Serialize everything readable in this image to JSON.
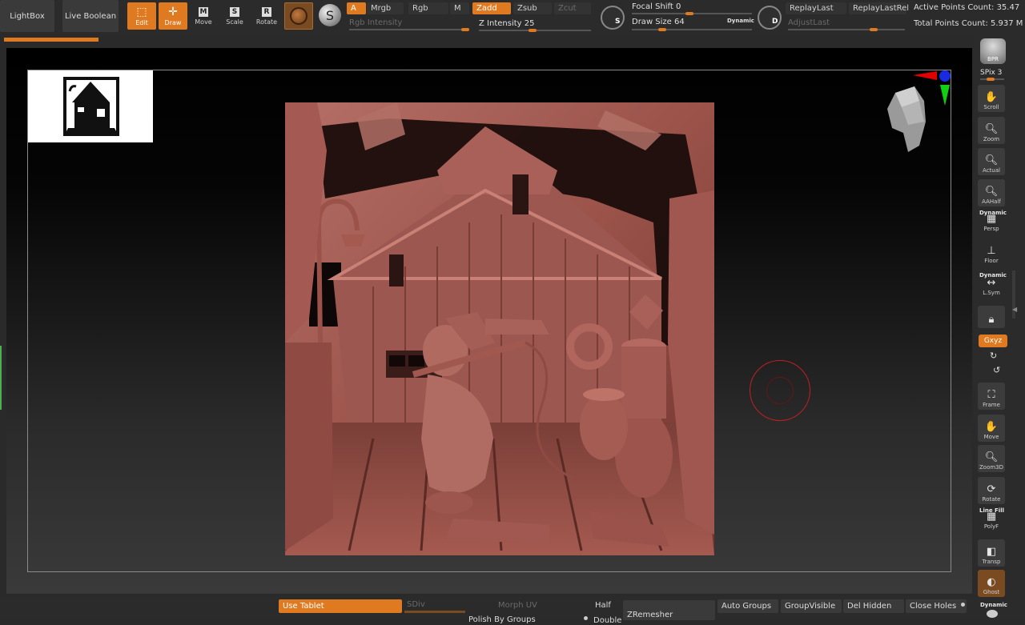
{
  "topbar": {
    "lightbox": "LightBox",
    "live_boolean": "Live Boolean",
    "tools": {
      "edit": "Edit",
      "draw": "Draw",
      "move": "Move",
      "scale": "Scale",
      "rotate": "Rotate"
    },
    "modes": {
      "a": "A",
      "mrgb": "Mrgb",
      "rgb": "Rgb",
      "m": "M",
      "zadd": "Zadd",
      "zsub": "Zsub",
      "zcut": "Zcut"
    },
    "rgb_intensity": "Rgb Intensity",
    "z_intensity": "Z Intensity 25",
    "focal_shift": "Focal Shift 0",
    "draw_size": "Draw Size 64",
    "dynamic": "Dynamic",
    "replay_last": "ReplayLast",
    "replay_last_rel": "ReplayLastRel",
    "adjust_last": "AdjustLast",
    "active_points": "Active Points Count: 35.47",
    "total_points": "Total Points Count: 5.937 M",
    "brush_s_key": "S",
    "brush_d_key": "D",
    "accent_color": "#e07a20"
  },
  "sidebar": {
    "bpr": "BPR",
    "spix": "SPix 3",
    "scroll": "Scroll",
    "zoom": "Zoom",
    "actual": "Actual",
    "aahalf": "AAHalf",
    "persp_dynamic": "Dynamic",
    "persp": "Persp",
    "floor": "Floor",
    "lsym_dynamic": "Dynamic",
    "lsym": "L.Sym",
    "xyz": "Gxyz",
    "frame": "Frame",
    "move": "Move",
    "zoom3d": "Zoom3D",
    "rotate": "Rotate",
    "line_fill": "Line Fill",
    "polyf": "PolyF",
    "transp": "Transp",
    "ghost": "Ghost",
    "solo_dynamic": "Dynamic"
  },
  "bottombar": {
    "use_tablet": "Use Tablet",
    "sdiv": "SDiv",
    "morph_uv": "Morph UV",
    "polish_by_groups": "Polish By Groups",
    "half": "Half",
    "zremesher": "ZRemesher",
    "auto_groups": "Auto Groups",
    "group_visible": "GroupVisible",
    "del_hidden": "Del Hidden",
    "close_holes": "Close Holes",
    "double": "Double"
  }
}
